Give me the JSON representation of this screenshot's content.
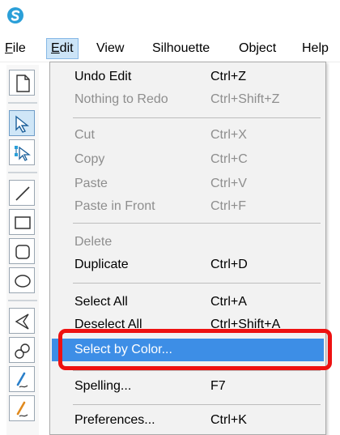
{
  "colors": {
    "accent": "#3d8ee6",
    "annotation": "#ee1111",
    "disabled_text": "#8e8e8e",
    "menu_bg": "#f2f2f2",
    "active_menu": "#cce4f7"
  },
  "app": {
    "logo_icon": "silhouette-logo-icon"
  },
  "menubar": {
    "items": [
      {
        "accel": "F",
        "rest": "ile",
        "active": false
      },
      {
        "accel": "E",
        "rest": "dit",
        "active": true
      },
      {
        "accel": "",
        "rest": "View",
        "active": false
      },
      {
        "accel": "",
        "rest": "Silhouette",
        "active": false
      },
      {
        "accel": "",
        "rest": "Object",
        "active": false
      },
      {
        "accel": "",
        "rest": "Help",
        "active": false
      }
    ]
  },
  "toolbar": {
    "tools": [
      "new-page-icon",
      "select-arrow-icon",
      "point-edit-icon",
      "line-tool-icon",
      "rectangle-tool-icon",
      "rounded-rectangle-tool-icon",
      "ellipse-tool-icon",
      "polygon-tool-icon",
      "curve-tool-icon",
      "freehand-tool-icon",
      "smooth-freehand-tool-icon"
    ],
    "selected": "select-arrow-icon"
  },
  "edit_menu": {
    "items": [
      {
        "label": "Undo Edit",
        "shortcut": "Ctrl+Z",
        "enabled": true
      },
      {
        "label": "Nothing to Redo",
        "shortcut": "Ctrl+Shift+Z",
        "enabled": false
      },
      {
        "label": "Cut",
        "shortcut": "Ctrl+X",
        "enabled": false
      },
      {
        "label": "Copy",
        "shortcut": "Ctrl+C",
        "enabled": false
      },
      {
        "label": "Paste",
        "shortcut": "Ctrl+V",
        "enabled": false
      },
      {
        "label": "Paste in Front",
        "shortcut": "Ctrl+F",
        "enabled": false
      },
      {
        "label": "Delete",
        "shortcut": "",
        "enabled": false
      },
      {
        "label": "Duplicate",
        "shortcut": "Ctrl+D",
        "enabled": true
      },
      {
        "label": "Select All",
        "shortcut": "Ctrl+A",
        "enabled": true
      },
      {
        "label": "Deselect All",
        "shortcut": "Ctrl+Shift+A",
        "enabled": true
      },
      {
        "label": "Select by Color...",
        "shortcut": "",
        "enabled": true,
        "highlighted": true
      },
      {
        "label": "Spelling...",
        "shortcut": "F7",
        "enabled": true
      },
      {
        "label": "Preferences...",
        "shortcut": "Ctrl+K",
        "enabled": true
      }
    ]
  }
}
